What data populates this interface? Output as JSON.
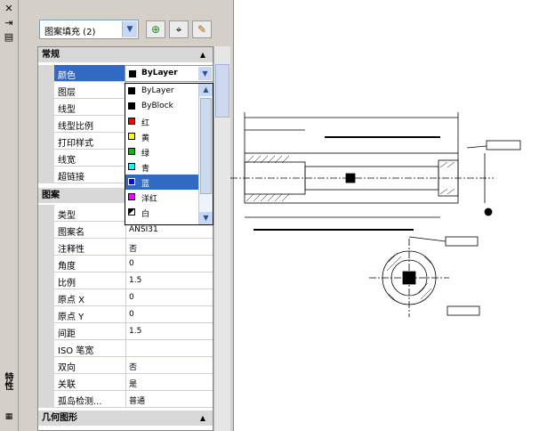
{
  "palette": {
    "vertical_title": "特性",
    "object_selector": "图案填充 (2)",
    "sections": {
      "general": "常规",
      "pattern": "图案",
      "geometry": "几何图形"
    },
    "general_rows": [
      {
        "name": "颜色",
        "value": "ByLayer"
      },
      {
        "name": "图层",
        "value": ""
      },
      {
        "name": "线型",
        "value": ""
      },
      {
        "name": "线型比例",
        "value": ""
      },
      {
        "name": "打印样式",
        "value": ""
      },
      {
        "name": "线宽",
        "value": ""
      },
      {
        "name": "超链接",
        "value": ""
      }
    ],
    "pattern_rows": [
      {
        "name": "类型",
        "value": ""
      },
      {
        "name": "图案名",
        "value": "ANSI31"
      },
      {
        "name": "注释性",
        "value": "否"
      },
      {
        "name": "角度",
        "value": "0"
      },
      {
        "name": "比例",
        "value": "1.5"
      },
      {
        "name": "原点 X",
        "value": "0"
      },
      {
        "name": "原点 Y",
        "value": "0"
      },
      {
        "name": "间距",
        "value": "1.5"
      },
      {
        "name": "ISO 笔宽",
        "value": ""
      },
      {
        "name": "双向",
        "value": "否"
      },
      {
        "name": "关联",
        "value": "是"
      },
      {
        "name": "孤岛检测...",
        "value": "普通"
      }
    ],
    "color_dropdown": {
      "current": "ByLayer",
      "options": [
        {
          "label": "ByLayer",
          "color": "#000000"
        },
        {
          "label": "ByBlock",
          "color": "#000000"
        },
        {
          "label": "红",
          "color": "#ff0000"
        },
        {
          "label": "黄",
          "color": "#ffff00"
        },
        {
          "label": "绿",
          "color": "#00c000"
        },
        {
          "label": "青",
          "color": "#00ffff"
        },
        {
          "label": "蓝",
          "color": "#0000ff"
        },
        {
          "label": "洋红",
          "color": "#ff00ff"
        },
        {
          "label": "白",
          "color": "#ffffff"
        }
      ],
      "highlighted_index": 6
    }
  },
  "accent_color": "#316ac5",
  "icons": [
    "close-icon",
    "pin-icon",
    "menu-icon",
    "toggle-pickadd-icon",
    "select-objects-icon",
    "quick-select-icon",
    "chevron-down-icon",
    "collapse-arrow-icon"
  ]
}
